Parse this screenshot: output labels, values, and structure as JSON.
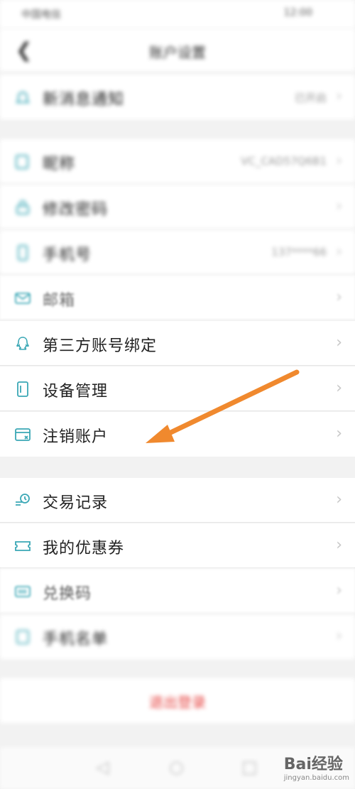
{
  "status": {
    "left": "中国电信",
    "right": "12:00"
  },
  "header": {
    "back_icon": "chevron-left-icon",
    "title": "账户设置"
  },
  "group1": [
    {
      "label": "新消息通知",
      "value": "已开启",
      "icon": "bell-icon"
    }
  ],
  "group2": [
    {
      "label": "昵称",
      "value": "VC_CAD57Q6B1",
      "icon": "edit-icon"
    },
    {
      "label": "修改密码",
      "value": "",
      "icon": "lock-icon"
    },
    {
      "label": "手机号",
      "value": "137****66",
      "icon": "phone-icon"
    },
    {
      "label": "邮箱",
      "value": "",
      "icon": "mail-icon"
    },
    {
      "label": "第三方账号绑定",
      "value": "",
      "icon": "qq-icon"
    },
    {
      "label": "设备管理",
      "value": "",
      "icon": "device-icon"
    },
    {
      "label": "注销账户",
      "value": "",
      "icon": "cancel-account-icon"
    }
  ],
  "group3": [
    {
      "label": "交易记录",
      "value": "",
      "icon": "history-icon"
    },
    {
      "label": "我的优惠券",
      "value": "",
      "icon": "coupon-icon"
    },
    {
      "label": "兑换码",
      "value": "",
      "icon": "barcode-icon"
    },
    {
      "label": "手机名单",
      "value": "",
      "icon": "list-icon"
    }
  ],
  "logout_label": "退出登录",
  "watermark": {
    "brand": "Bai经验",
    "url": "jingyan.baidu.com"
  },
  "colors": {
    "accent": "#3aa7b5",
    "arrow": "#f0892e",
    "danger": "#e64340"
  }
}
